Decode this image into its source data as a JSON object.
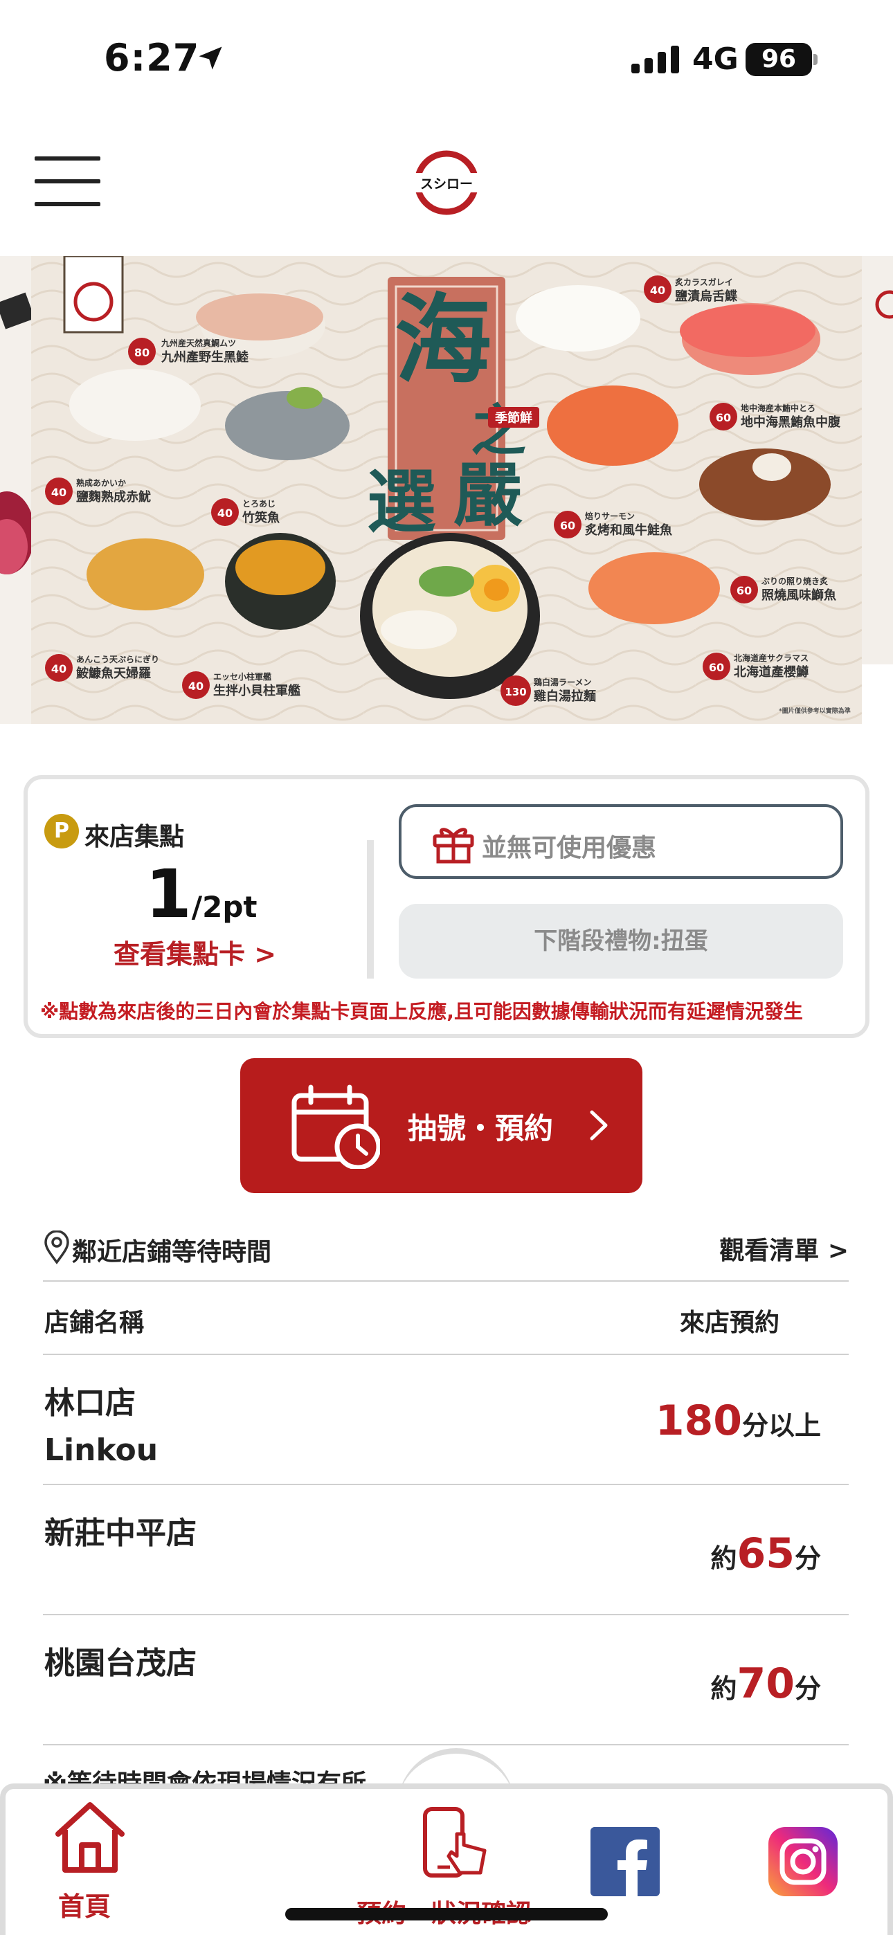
{
  "status_bar": {
    "time": "6:27",
    "network": "4G",
    "battery": "96",
    "icons": [
      "location-arrow-icon",
      "signal-bars-icon",
      "battery-icon"
    ]
  },
  "header": {
    "logo_text": "スシロー",
    "menu_icon": "hamburger-icon"
  },
  "banner": {
    "title_main": "海之嚴選",
    "tag": "季節鮮",
    "items": [
      {
        "price": "80",
        "name_jp": "九州産天然真鯛ムツ",
        "name": "九州產野生黑鯥"
      },
      {
        "price": "40",
        "name_jp": "炙カラスガレイ",
        "name": "鹽漬烏舌鰈"
      },
      {
        "price": "60",
        "name_jp": "地中海産本鮪中とろ",
        "name": "地中海黑鮪魚中腹"
      },
      {
        "price": "40",
        "name_jp": "熟成あかいか",
        "name": "鹽麴熟成赤魷"
      },
      {
        "price": "40",
        "name_jp": "とろあじ",
        "name": "竹筴魚"
      },
      {
        "price": "60",
        "name_jp": "焙りサーモン",
        "name": "炙烤和風牛鮭魚"
      },
      {
        "price": "60",
        "name_jp": "ぶりの照り焼き炙",
        "name": "照燒風味鰤魚"
      },
      {
        "price": "40",
        "name_jp": "あんこう天ぷらにぎり",
        "name": "鮟鱇魚天婦羅"
      },
      {
        "price": "40",
        "name_jp": "エッセ小柱軍艦",
        "name": "生拌小貝柱軍艦"
      },
      {
        "price": "130",
        "name_jp": "鶏白湯ラーメン",
        "name": "雞白湯拉麵"
      },
      {
        "price": "60",
        "name_jp": "北海道産サクラマス",
        "name": "北海道產櫻鱒"
      }
    ],
    "fineprint": "*圖片僅供參考以實際為準"
  },
  "points_card": {
    "badge": "P",
    "title": "來店集點",
    "points_value": "1",
    "points_unit": "/2pt",
    "view_card_link": "查看集點卡 >",
    "coupon_text": "並無可使用優惠",
    "next_gift": "下階段禮物:扭蛋",
    "note": "※點數為來店後的三日內會於集點卡頁面上反應,且可能因數據傳輸狀況而有延遲情況發生"
  },
  "reserve_button": {
    "label": "抽號・預約",
    "icon": "calendar-clock-icon"
  },
  "nearby": {
    "title": "鄰近店鋪等待時間",
    "view_list": "觀看清單 >",
    "col_store": "店鋪名稱",
    "col_wait": "來店預約",
    "rows": [
      {
        "name": "林口店",
        "name_en": "Linkou",
        "prefix": "",
        "value": "180",
        "suffix": "分以上"
      },
      {
        "name": "新莊中平店",
        "name_en": "",
        "prefix": "約",
        "value": "65",
        "suffix": "分"
      },
      {
        "name": "桃園台茂店",
        "name_en": "",
        "prefix": "約",
        "value": "70",
        "suffix": "分"
      }
    ],
    "footnote": "※等待時間會依現場情況有所"
  },
  "tab_bar": {
    "home": "首頁",
    "reserve_status": "預約・狀況確認",
    "icons": [
      "home-icon",
      "phone-tap-icon",
      "facebook-icon",
      "instagram-icon"
    ]
  },
  "colors": {
    "brand_red": "#b81f24",
    "button_red": "#b71c1c",
    "coin_gold": "#c89b10",
    "facebook_blue": "#3a589b"
  }
}
